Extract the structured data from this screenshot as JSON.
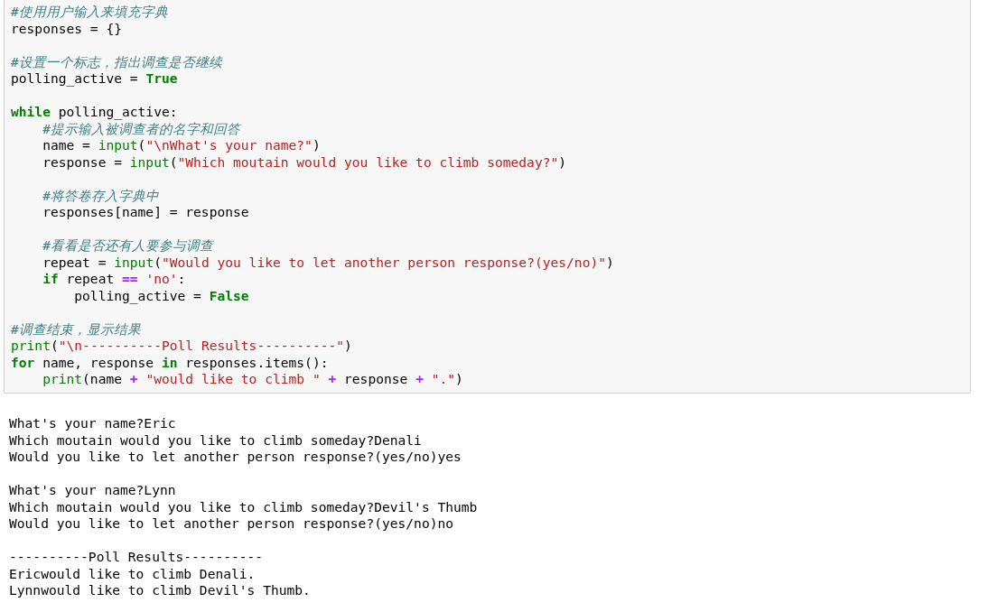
{
  "code_cell": {
    "lines": [
      {
        "kind": "code",
        "tokens": [
          {
            "kind": "comment",
            "text": "#使用用户输入来填充字典"
          }
        ]
      },
      {
        "kind": "code",
        "tokens": [
          {
            "kind": "plain",
            "text": "responses = {}"
          }
        ]
      },
      {
        "kind": "blank"
      },
      {
        "kind": "code",
        "tokens": [
          {
            "kind": "comment",
            "text": "#设置一个标志，指出调查是否继续"
          }
        ]
      },
      {
        "kind": "code",
        "tokens": [
          {
            "kind": "plain",
            "text": "polling_active = "
          },
          {
            "kind": "keyword",
            "text": "True"
          }
        ]
      },
      {
        "kind": "blank"
      },
      {
        "kind": "code",
        "tokens": [
          {
            "kind": "keyword",
            "text": "while"
          },
          {
            "kind": "plain",
            "text": " polling_active:"
          }
        ]
      },
      {
        "kind": "code",
        "tokens": [
          {
            "kind": "comment",
            "text": "    #提示输入被调查者的名字和回答"
          }
        ]
      },
      {
        "kind": "code",
        "tokens": [
          {
            "kind": "plain",
            "text": "    name = "
          },
          {
            "kind": "builtin",
            "text": "input"
          },
          {
            "kind": "plain",
            "text": "("
          },
          {
            "kind": "string",
            "text": "\"\\nWhat's your name?\""
          },
          {
            "kind": "plain",
            "text": ")"
          }
        ]
      },
      {
        "kind": "code",
        "tokens": [
          {
            "kind": "plain",
            "text": "    response = "
          },
          {
            "kind": "builtin",
            "text": "input"
          },
          {
            "kind": "plain",
            "text": "("
          },
          {
            "kind": "string",
            "text": "\"Which moutain would you like to climb someday?\""
          },
          {
            "kind": "plain",
            "text": ")"
          }
        ]
      },
      {
        "kind": "blank"
      },
      {
        "kind": "code",
        "tokens": [
          {
            "kind": "comment",
            "text": "    #将答卷存入字典中"
          }
        ]
      },
      {
        "kind": "code",
        "tokens": [
          {
            "kind": "plain",
            "text": "    responses[name] = response"
          }
        ]
      },
      {
        "kind": "blank"
      },
      {
        "kind": "code",
        "tokens": [
          {
            "kind": "comment",
            "text": "    #看看是否还有人要参与调查"
          }
        ]
      },
      {
        "kind": "code",
        "tokens": [
          {
            "kind": "plain",
            "text": "    repeat = "
          },
          {
            "kind": "builtin",
            "text": "input"
          },
          {
            "kind": "plain",
            "text": "("
          },
          {
            "kind": "string",
            "text": "\"Would you like to let another person response?(yes/no)\""
          },
          {
            "kind": "plain",
            "text": ")"
          }
        ]
      },
      {
        "kind": "code",
        "tokens": [
          {
            "kind": "keyword",
            "text": "    if"
          },
          {
            "kind": "plain",
            "text": " repeat "
          },
          {
            "kind": "operator",
            "text": "== "
          },
          {
            "kind": "string",
            "text": "'no'"
          },
          {
            "kind": "plain",
            "text": ":"
          }
        ]
      },
      {
        "kind": "code",
        "tokens": [
          {
            "kind": "plain",
            "text": "        polling_active = "
          },
          {
            "kind": "keyword",
            "text": "False"
          }
        ]
      },
      {
        "kind": "blank"
      },
      {
        "kind": "code",
        "tokens": [
          {
            "kind": "comment",
            "text": "#调查结束，显示结果"
          }
        ]
      },
      {
        "kind": "code",
        "tokens": [
          {
            "kind": "builtin",
            "text": "print"
          },
          {
            "kind": "plain",
            "text": "("
          },
          {
            "kind": "string",
            "text": "\"\\n----------Poll Results----------\""
          },
          {
            "kind": "plain",
            "text": ")"
          }
        ]
      },
      {
        "kind": "code",
        "tokens": [
          {
            "kind": "keyword",
            "text": "for"
          },
          {
            "kind": "plain",
            "text": " name, response "
          },
          {
            "kind": "keyword",
            "text": "in"
          },
          {
            "kind": "plain",
            "text": " responses.items():"
          }
        ]
      },
      {
        "kind": "code",
        "tokens": [
          {
            "kind": "builtin",
            "text": "    print"
          },
          {
            "kind": "plain",
            "text": "(name "
          },
          {
            "kind": "operator",
            "text": "+ "
          },
          {
            "kind": "string",
            "text": "\"would like to climb \""
          },
          {
            "kind": "operator",
            "text": " +"
          },
          {
            "kind": "plain",
            "text": " response "
          },
          {
            "kind": "operator",
            "text": "+ "
          },
          {
            "kind": "string",
            "text": "\".\""
          },
          {
            "kind": "plain",
            "text": ")"
          }
        ]
      }
    ]
  },
  "output": {
    "lines": [
      {
        "kind": "blank"
      },
      {
        "kind": "text",
        "text": "What's your name?Eric"
      },
      {
        "kind": "text",
        "text": "Which moutain would you like to climb someday?Denali"
      },
      {
        "kind": "text",
        "text": "Would you like to let another person response?(yes/no)yes"
      },
      {
        "kind": "blank"
      },
      {
        "kind": "text",
        "text": "What's your name?Lynn"
      },
      {
        "kind": "text",
        "text": "Which moutain would you like to climb someday?Devil's Thumb"
      },
      {
        "kind": "text",
        "text": "Would you like to let another person response?(yes/no)no"
      },
      {
        "kind": "blank"
      },
      {
        "kind": "text",
        "text": "----------Poll Results----------"
      },
      {
        "kind": "text",
        "text": "Ericwould like to climb Denali."
      },
      {
        "kind": "text",
        "text": "Lynnwould like to climb Devil's Thumb."
      }
    ]
  }
}
